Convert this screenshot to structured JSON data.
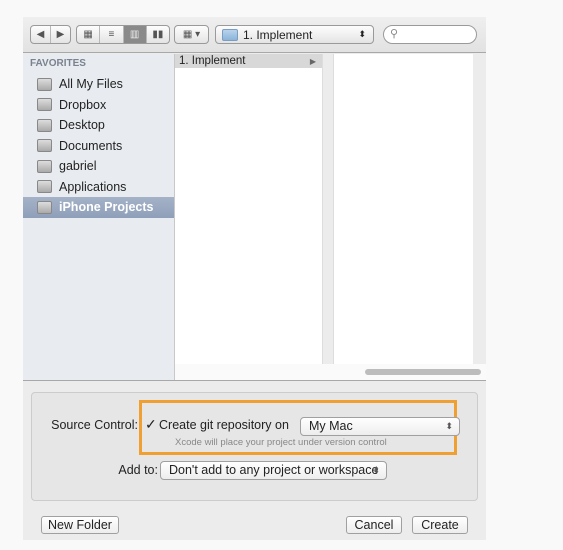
{
  "toolbar": {
    "back": "◀",
    "forward": "▶",
    "view_icon": "▦",
    "view_list": "≡",
    "view_column": "▥",
    "view_coverflow": "▮▮",
    "arrange": "▦ ▾",
    "path": "1. Implement",
    "path_arrows": "⬍",
    "search_placeholder": "",
    "search_icon": "magnifier"
  },
  "sidebar": {
    "header": "FAVORITES",
    "items": [
      {
        "label": "All My Files",
        "icon": "all-files"
      },
      {
        "label": "Dropbox",
        "icon": "folder"
      },
      {
        "label": "Desktop",
        "icon": "desktop"
      },
      {
        "label": "Documents",
        "icon": "documents"
      },
      {
        "label": "gabriel",
        "icon": "home"
      },
      {
        "label": "Applications",
        "icon": "applications"
      },
      {
        "label": "iPhone Projects",
        "icon": "folder",
        "selected": true
      }
    ]
  },
  "browser": {
    "column1": [
      {
        "label": "1. Implement",
        "arrow": "▶"
      }
    ]
  },
  "options": {
    "source_control_label": "Source Control:",
    "git_checkbox_label": "Create git repository on",
    "git_checked": true,
    "git_location": "My Mac",
    "git_hint": "Xcode will place your project under version control",
    "add_to_label": "Add to:",
    "add_to_value": "Don't add to any project or workspace",
    "highlight_color": "#f0a030"
  },
  "buttons": {
    "new_folder": "New Folder",
    "cancel": "Cancel",
    "create": "Create"
  }
}
